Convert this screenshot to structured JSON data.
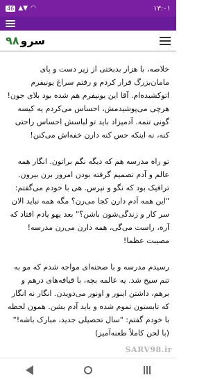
{
  "status_bar": {
    "time": "۱۳:۰۱",
    "battery": "46",
    "signal": "▲▼",
    "wifi": "◠",
    "colors": {
      "background": "#7b1fa2"
    }
  },
  "header": {
    "title_text": "سرو",
    "title_number": "۹۸",
    "colors": {
      "number": "#2e7d32"
    }
  },
  "article": {
    "paragraphs": [
      "خلاصه، با هزار بدبختی از زیر دست و پای مامان‌بزرگ فرار کردم و رفتم سراغ یونیفرم اتوکشیده‌ام. آقا این یونیفرم هم شده بود بلای جون! هرچی می‌پوشیدمش، احساس می‌کردم یه کیسه گونی تنمه. آدمیزاد باید تو لباسش احساس راحتی کنه، نه اینکه حس کنه دارن خفه‌اش می‌کنن!",
      "تو راه مدرسه هم که دیگه نگم براتون. انگار همه عالم و آدم تصمیم گرفته بودن امروز برن بیرون. ترافیک بود که نگو و نپرس. هی با خودم می‌گفتم: \"این همه آدم دارن کجا می‌رن؟ مگه همه نباید الان سر کار و زندگی‌شون باشن؟\" بعد یهو یادم افتاد که آره، راست می‌گی، همه دارن می‌رن مدرسه! مصیبت عظما!",
      "رسیدم مدرسه و با صحنه‌ای مواجه شدم که مو به تنم سیخ شد. یه عالمه بچه، با قیافه‌های درهم و برهم، داشتن اینور و اونور می‌دویدن. انگار نه انگار که تابستون تموم شده و باید آدم بشن. همون لحظه با خودم گفتم: \"سال تحصیلی جدید، مبارک باشه!\" (با لحن کاملاً طعنه‌آمیز)"
    ]
  },
  "watermark": "SARV98.ir",
  "nav": {
    "back": "back",
    "home": "home",
    "recent": "recent"
  }
}
